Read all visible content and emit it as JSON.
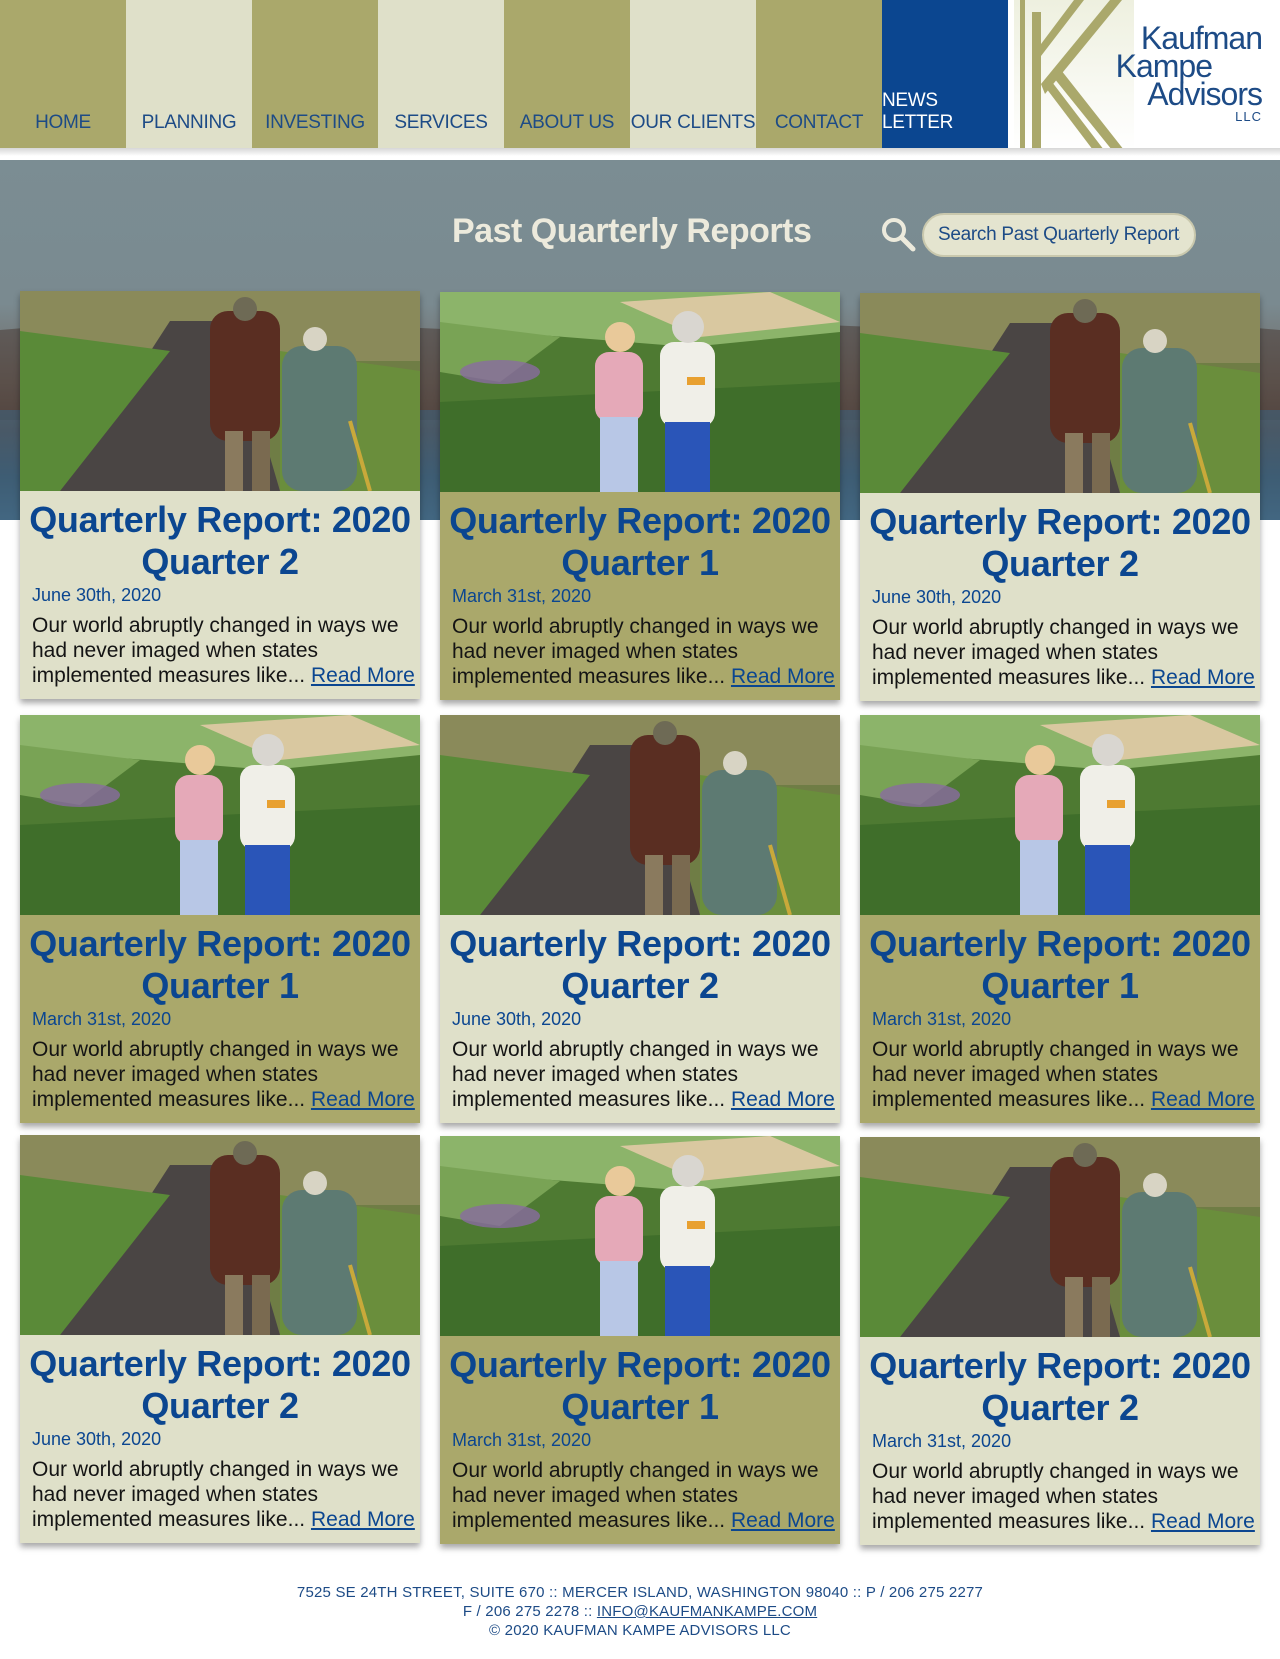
{
  "nav": {
    "items": [
      {
        "label": "HOME"
      },
      {
        "label": "PLANNING"
      },
      {
        "label": "INVESTING"
      },
      {
        "label": "SERVICES"
      },
      {
        "label": "ABOUT US"
      },
      {
        "label": "OUR CLIENTS"
      },
      {
        "label": "CONTACT"
      },
      {
        "label": "NEWS LETTER"
      }
    ]
  },
  "logo": {
    "line1": "Kaufman",
    "line2": "Kampe",
    "line3": "Advisors",
    "llc": "LLC"
  },
  "hero": {
    "title": "Past Quarterly Reports",
    "search_placeholder": "Search Past Quarterly Reports"
  },
  "cards": [
    {
      "title_line1": "Quarterly Report: 2020",
      "title_line2": "Quarter 2",
      "date": "June 30th, 2020",
      "excerpt": "Our world abruptly changed in ways we had never imaged when states implemented measures like...",
      "read_more": "Read More",
      "image": "couple-walking-path"
    },
    {
      "title_line1": "Quarterly Report: 2020",
      "title_line2": "Quarter 1",
      "date": "March 31st, 2020",
      "excerpt": "Our world abruptly changed in ways we had never imaged when states implemented measures like...",
      "read_more": "Read More",
      "image": "grandmother-granddaughter-hiking"
    },
    {
      "title_line1": "Quarterly Report: 2020",
      "title_line2": "Quarter 2",
      "date": "June 30th, 2020",
      "excerpt": "Our world abruptly changed in ways we had never imaged when states implemented measures like...",
      "read_more": "Read More",
      "image": "couple-walking-path"
    },
    {
      "title_line1": "Quarterly Report: 2020",
      "title_line2": "Quarter 1",
      "date": "March 31st, 2020",
      "excerpt": "Our world abruptly changed in ways we had never imaged when states implemented measures like...",
      "read_more": "Read More",
      "image": "grandmother-granddaughter-hiking"
    },
    {
      "title_line1": "Quarterly Report: 2020",
      "title_line2": "Quarter 2",
      "date": "June 30th, 2020",
      "excerpt": "Our world abruptly changed in ways we had never imaged when states implemented measures like...",
      "read_more": "Read More",
      "image": "couple-walking-path"
    },
    {
      "title_line1": "Quarterly Report: 2020",
      "title_line2": "Quarter 1",
      "date": "March 31st, 2020",
      "excerpt": "Our world abruptly changed in ways we had never imaged when states implemented measures like...",
      "read_more": "Read More",
      "image": "grandmother-granddaughter-hiking"
    },
    {
      "title_line1": "Quarterly Report: 2020",
      "title_line2": "Quarter 2",
      "date": "June 30th, 2020",
      "excerpt": "Our world abruptly changed in ways we had never imaged when states implemented measures like...",
      "read_more": "Read More",
      "image": "couple-walking-path"
    },
    {
      "title_line1": "Quarterly Report: 2020",
      "title_line2": "Quarter 1",
      "date": "March 31st, 2020",
      "excerpt": "Our world abruptly changed in ways we had never imaged when states implemented measures like...",
      "read_more": "Read More",
      "image": "grandmother-granddaughter-hiking"
    },
    {
      "title_line1": "Quarterly Report: 2020",
      "title_line2": "Quarter 2",
      "date": "March 31st, 2020",
      "excerpt": "Our world abruptly changed in ways we had never imaged when states implemented measures like...",
      "read_more": "Read More",
      "image": "couple-walking-path"
    }
  ],
  "footer": {
    "line1": "7525 SE 24TH STREET, SUITE 670 :: MERCER ISLAND, WASHINGTON 98040 :: P / 206 275 2277",
    "line2_prefix": "F / 206 275 2278 :: ",
    "email": "INFO@KAUFMANKAMPE.COM",
    "line3": "© 2020 KAUFMAN KAMPE ADVISORS LLC"
  },
  "colors": {
    "olive": "#aaa86b",
    "cream": "#dfe0c9",
    "navy": "#0b4690",
    "text_blue": "#1d4b86"
  }
}
